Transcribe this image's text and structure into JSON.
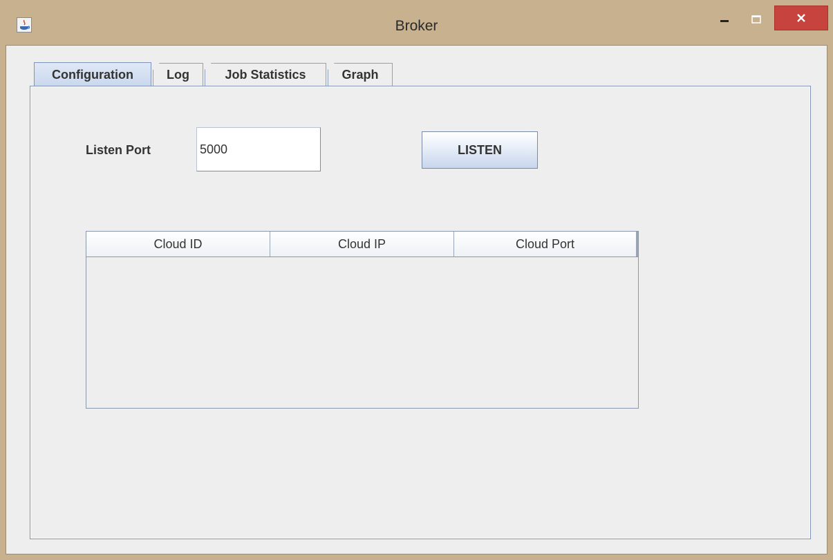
{
  "window": {
    "title": "Broker",
    "controls": {
      "minimize": "–",
      "maximize": "☐",
      "close": "✕"
    }
  },
  "tabs": [
    {
      "label": "Configuration",
      "selected": true
    },
    {
      "label": "Log",
      "selected": false
    },
    {
      "label": "Job Statistics",
      "selected": false
    },
    {
      "label": "Graph",
      "selected": false
    }
  ],
  "configuration": {
    "listen_port_label": "Listen Port",
    "listen_port_value": "5000",
    "listen_button_label": "LISTEN",
    "table": {
      "columns": [
        "Cloud ID",
        "Cloud IP",
        "Cloud Port"
      ],
      "rows": []
    }
  },
  "colors": {
    "titlebar": "#c8b18f",
    "close_button": "#c7443e",
    "panel_background": "#eeeeee",
    "tab_selected": "#c9d7ed"
  }
}
